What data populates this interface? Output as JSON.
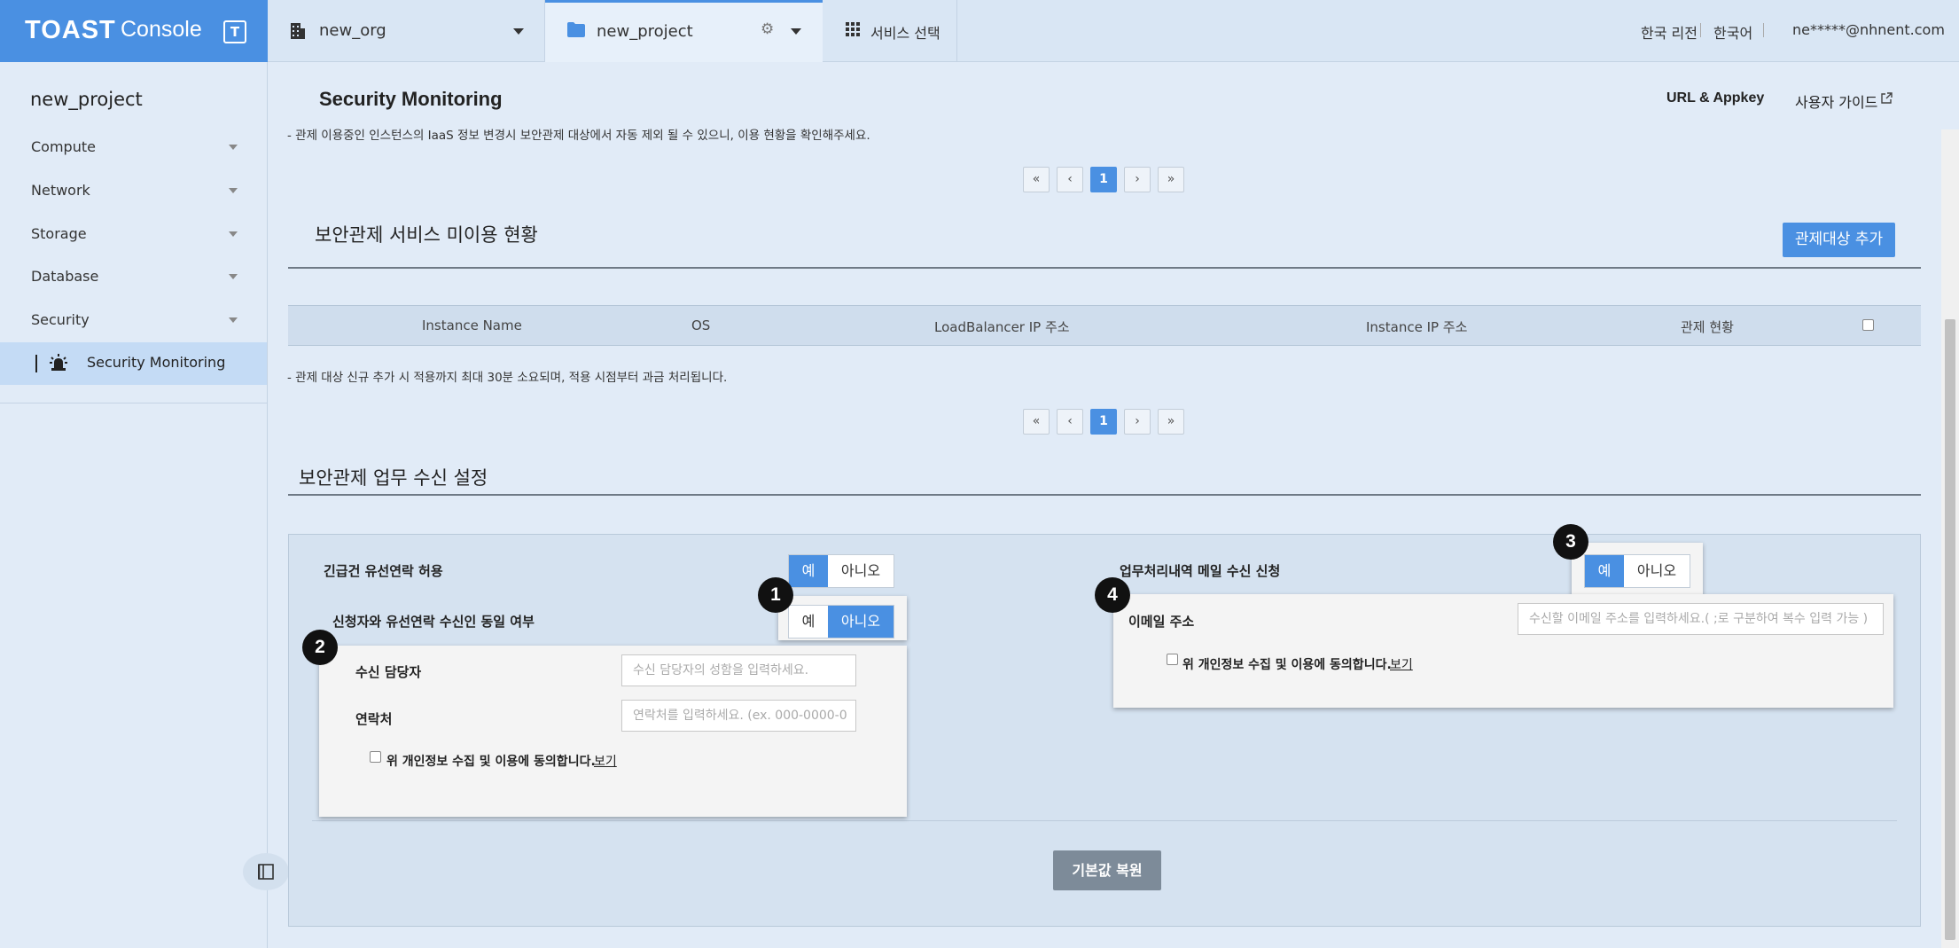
{
  "topbar": {
    "logo_brand": "TOAST",
    "logo_console": "Console",
    "logo_box": "T",
    "org_name": "new_org",
    "project_name": "new_project",
    "service_select": "서비스 선택",
    "region": "한국 리전",
    "language": "한국어",
    "user_email": "ne*****@nhnent.com"
  },
  "sidebar": {
    "project_name": "new_project",
    "items": [
      {
        "label": "Compute",
        "icon": "chevron-down-icon"
      },
      {
        "label": "Network",
        "icon": "chevron-down-icon"
      },
      {
        "label": "Storage",
        "icon": "chevron-down-icon"
      },
      {
        "label": "Database",
        "icon": "chevron-down-icon"
      },
      {
        "label": "Security",
        "icon": "chevron-down-icon"
      }
    ],
    "active_item": "Security Monitoring"
  },
  "header": {
    "title": "Security Monitoring",
    "url_appkey": "URL & Appkey",
    "user_guide": "사용자 가이드"
  },
  "section1": {
    "note": "- 관제 이용중인 인스턴스의 IaaS 정보 변경시 보안관제 대상에서 자동 제외 될 수 있으니, 이용 현황을 확인해주세요.",
    "pager": [
      "«",
      "‹",
      "1",
      "›",
      "»"
    ]
  },
  "section2": {
    "title": "보안관제 서비스 미이용 현황",
    "add_button": "관제대상 추가",
    "columns": [
      "Instance Name",
      "OS",
      "LoadBalancer IP 주소",
      "Instance IP 주소",
      "관제 현황"
    ],
    "note": "- 관제 대상 신규 추가 시 적용까지 최대 30분 소요되며, 적용 시점부터 과금 처리됩니다.",
    "pager": [
      "«",
      "‹",
      "1",
      "›",
      "»"
    ]
  },
  "section3": {
    "title": "보안관제 업무 수신 설정",
    "emergency_label": "긴급건 유선연락 허용",
    "yes": "예",
    "no": "아니오",
    "same_person_label": "신청자와 유선연락 수신인 동일 여부",
    "receiver_label": "수신 담당자",
    "receiver_placeholder": "수신 담당자의 성함을 입력하세요.",
    "contact_label": "연락처",
    "contact_placeholder": "연락처를 입력하세요. (ex. 000-0000-0",
    "consent_text": "위 개인정보 수집 및 이용에 동의합니다.",
    "view": "보기",
    "mail_label": "업무처리내역 메일 수신 신청",
    "email_label": "이메일 주소",
    "email_placeholder": "수신할 이메일 주소를 입력하세요.( ;로 구분하여 복수 입력 가능 )",
    "reset_button": "기본값 복원",
    "badges": [
      "1",
      "2",
      "3",
      "4"
    ]
  },
  "colors": {
    "accent": "#4a90e2",
    "background": "#e1ebf7",
    "reset_button": "#7d8b99"
  }
}
